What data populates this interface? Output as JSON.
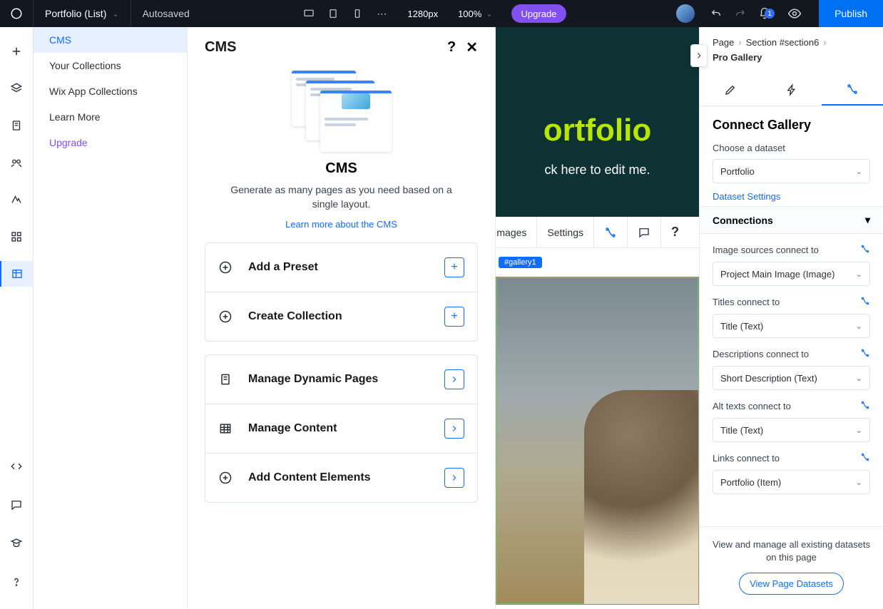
{
  "topbar": {
    "page_name": "Portfolio (List)",
    "save_status": "Autosaved",
    "breakpoint_label": "1280px",
    "zoom_label": "100%",
    "upgrade_label": "Upgrade",
    "notification_count": "1",
    "publish_label": "Publish"
  },
  "submenu": {
    "items": [
      {
        "label": "CMS"
      },
      {
        "label": "Your Collections"
      },
      {
        "label": "Wix App Collections"
      },
      {
        "label": "Learn More"
      },
      {
        "label": "Upgrade"
      }
    ]
  },
  "cms_panel": {
    "header_title": "CMS",
    "intro_heading": "CMS",
    "intro_text": "Generate as many pages as you need based on a single layout.",
    "intro_link": "Learn more about the CMS",
    "group1": [
      {
        "label": "Add a Preset",
        "tail": "+"
      },
      {
        "label": "Create Collection",
        "tail": "+"
      }
    ],
    "group2": [
      {
        "label": "Manage Dynamic Pages",
        "tail": ">"
      },
      {
        "label": "Manage Content",
        "tail": ">"
      },
      {
        "label": "Add Content Elements",
        "tail": ">"
      }
    ]
  },
  "canvas": {
    "hero_title": "ortfolio",
    "hero_subtitle": "ck here to edit me.",
    "toolbar": {
      "images": "Images",
      "settings": "Settings"
    },
    "hash_badge": "#gallery1"
  },
  "inspector": {
    "breadcrumb": [
      "Page",
      "Section #section6",
      "Pro Gallery"
    ],
    "panel_title": "Connect Gallery",
    "dataset_label": "Choose a dataset",
    "dataset_value": "Portfolio",
    "dataset_settings_link": "Dataset Settings",
    "connections_header": "Connections",
    "connections": [
      {
        "label": "Image sources connect to",
        "value": "Project Main Image (Image)"
      },
      {
        "label": "Titles connect to",
        "value": "Title (Text)"
      },
      {
        "label": "Descriptions connect to",
        "value": "Short Description (Text)"
      },
      {
        "label": "Alt texts connect to",
        "value": "Title (Text)"
      },
      {
        "label": "Links connect to",
        "value": "Portfolio (Item)"
      }
    ],
    "footer_text": "View and manage all existing datasets on this page",
    "footer_button": "View Page Datasets"
  }
}
